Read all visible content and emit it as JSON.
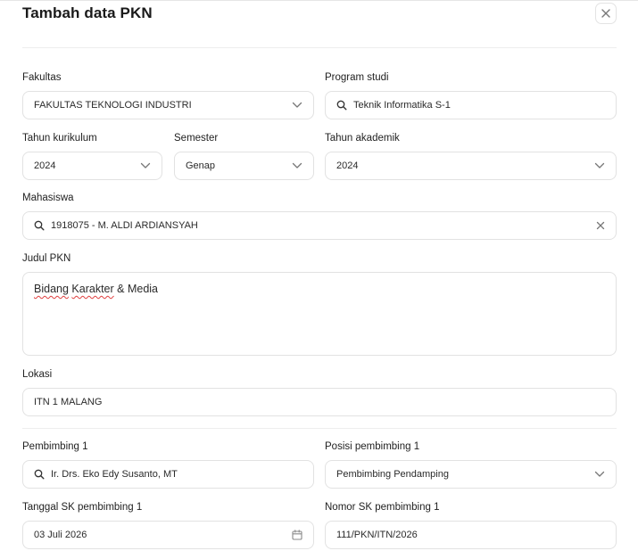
{
  "dialog": {
    "title": "Tambah data PKN"
  },
  "form": {
    "fakultas": {
      "label": "Fakultas",
      "value": "FAKULTAS TEKNOLOGI INDUSTRI"
    },
    "program_studi": {
      "label": "Program studi",
      "value": "Teknik Informatika S-1"
    },
    "tahun_kurikulum": {
      "label": "Tahun kurikulum",
      "value": "2024"
    },
    "semester": {
      "label": "Semester",
      "value": "Genap"
    },
    "tahun_akademik": {
      "label": "Tahun akademik",
      "value": "2024"
    },
    "mahasiswa": {
      "label": "Mahasiswa",
      "value": "1918075 - M. ALDI ARDIANSYAH"
    },
    "judul_pkn": {
      "label": "Judul PKN",
      "value_part1": "Bidang",
      "value_part2": "Karakter",
      "value_part3": "& Media"
    },
    "lokasi": {
      "label": "Lokasi",
      "value": "ITN 1 MALANG"
    },
    "pembimbing1": {
      "label": "Pembimbing 1",
      "value": "Ir. Drs. Eko Edy Susanto, MT"
    },
    "posisi_pembimbing1": {
      "label": "Posisi pembimbing 1",
      "value": "Pembimbing Pendamping"
    },
    "tanggal_sk1": {
      "label": "Tanggal SK pembimbing 1",
      "value": "03 Juli 2026"
    },
    "nomor_sk1": {
      "label": "Nomor SK pembimbing 1",
      "value": "111/PKN/ITN/2026"
    }
  },
  "icons": {
    "close": "close-icon",
    "chevron": "chevron-down-icon",
    "search": "search-icon",
    "clear": "clear-icon",
    "calendar": "calendar-icon"
  },
  "colors": {
    "border": "#e2e2e2",
    "spellcheck": "#e04040"
  }
}
